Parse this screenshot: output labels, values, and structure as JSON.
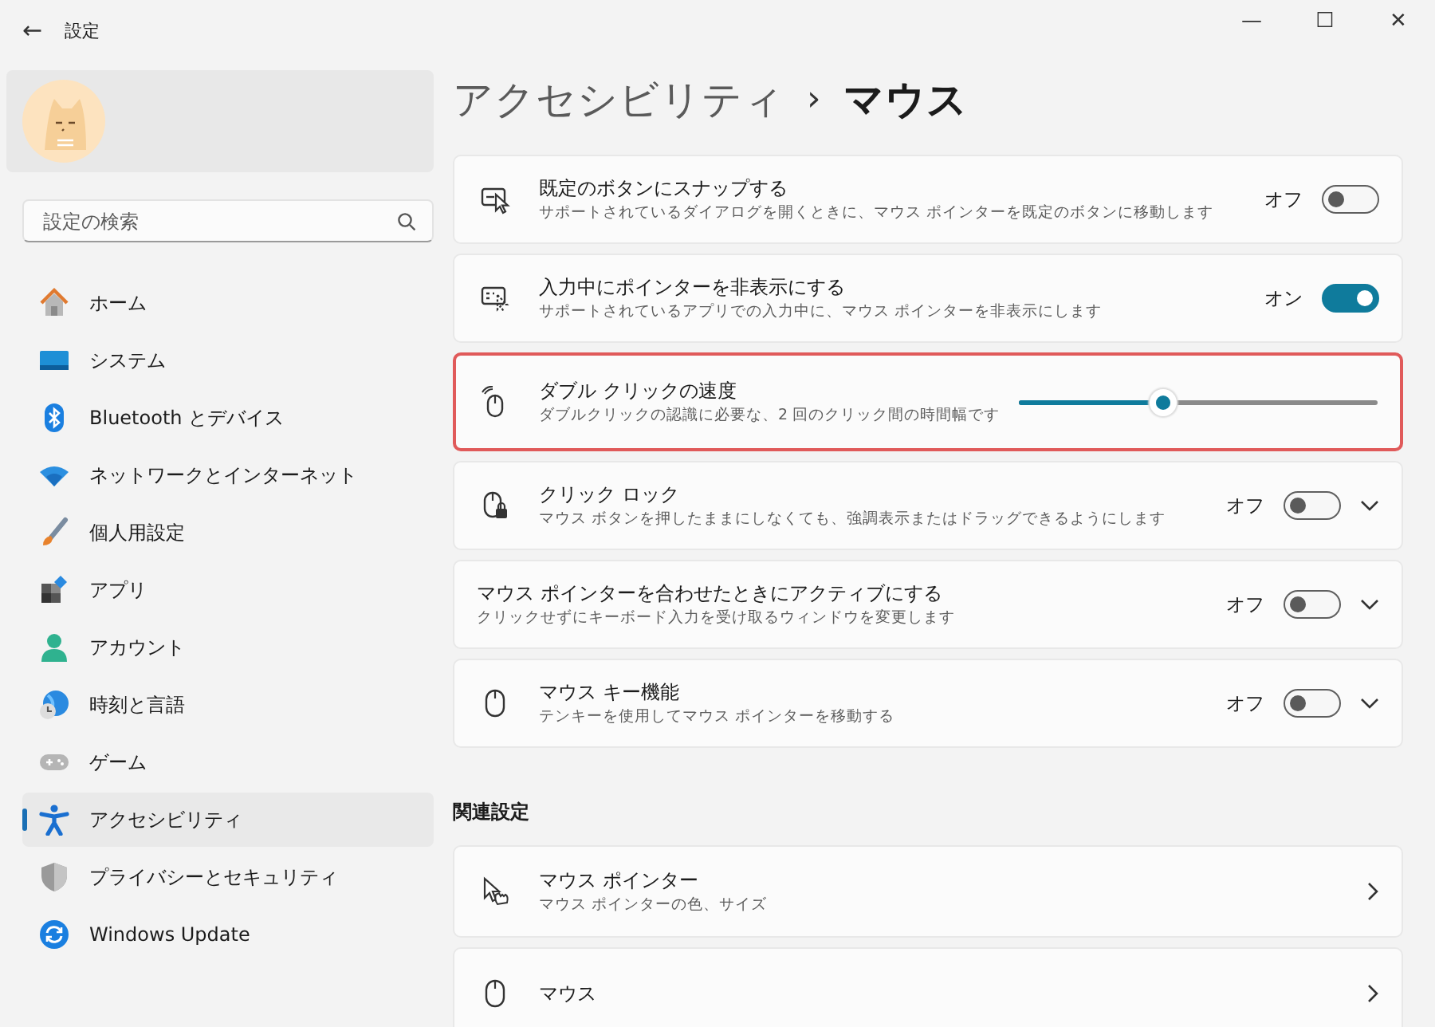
{
  "window": {
    "title": "設定",
    "back": "←",
    "controls": [
      "—",
      "☐",
      "✕"
    ]
  },
  "search": {
    "placeholder": "設定の検索"
  },
  "sidebar": {
    "items": [
      {
        "label": "ホーム",
        "selected": false
      },
      {
        "label": "システム",
        "selected": false
      },
      {
        "label": "Bluetooth とデバイス",
        "selected": false
      },
      {
        "label": "ネットワークとインターネット",
        "selected": false
      },
      {
        "label": "個人用設定",
        "selected": false
      },
      {
        "label": "アプリ",
        "selected": false
      },
      {
        "label": "アカウント",
        "selected": false
      },
      {
        "label": "時刻と言語",
        "selected": false
      },
      {
        "label": "ゲーム",
        "selected": false
      },
      {
        "label": "アクセシビリティ",
        "selected": true
      },
      {
        "label": "プライバシーとセキュリティ",
        "selected": false
      },
      {
        "label": "Windows Update",
        "selected": false
      }
    ]
  },
  "breadcrumb": {
    "parent": "アクセシビリティ",
    "separator": "›",
    "current": "マウス"
  },
  "settings": [
    {
      "kind": "toggle",
      "title": "既定のボタンにスナップする",
      "description": "サポートされているダイアログを開くときに、マウス ポインターを既定のボタンに移動します",
      "state_label": "オフ",
      "on": false,
      "expandable": false,
      "highlighted": false
    },
    {
      "kind": "toggle",
      "title": "入力中にポインターを非表示にする",
      "description": "サポートされているアプリでの入力中に、マウス ポインターを非表示にします",
      "state_label": "オン",
      "on": true,
      "expandable": false,
      "highlighted": false
    },
    {
      "kind": "slider",
      "title": "ダブル クリックの速度",
      "description": "ダブルクリックの認識に必要な、2 回のクリック間の時間幅です",
      "level": 0.4,
      "highlighted": true
    },
    {
      "kind": "toggle",
      "title": "クリック ロック",
      "description": "マウス ボタンを押したままにしなくても、強調表示またはドラッグできるようにします",
      "state_label": "オフ",
      "on": false,
      "expandable": true,
      "highlighted": false
    },
    {
      "kind": "toggle",
      "title": "マウス ポインターを合わせたときにアクティブにする",
      "description": "クリックせずにキーボード入力を受け取るウィンドウを変更します",
      "state_label": "オフ",
      "on": false,
      "expandable": true,
      "highlighted": false
    },
    {
      "kind": "toggle",
      "title": "マウス キー機能",
      "description": "テンキーを使用してマウス ポインターを移動する",
      "state_label": "オフ",
      "on": false,
      "expandable": true,
      "highlighted": false
    }
  ],
  "related": {
    "heading": "関連設定",
    "items": [
      {
        "title": "マウス ポインター",
        "description": "マウス ポインターの色、サイズ"
      },
      {
        "title": "マウス"
      }
    ]
  }
}
